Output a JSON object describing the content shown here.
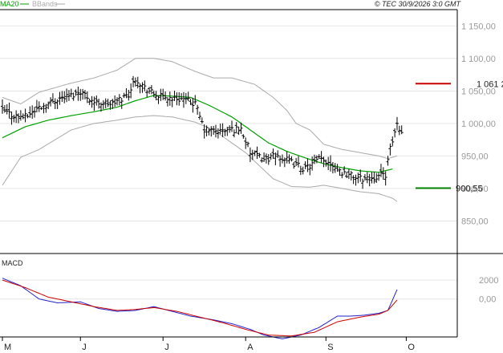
{
  "header": {
    "copyright": "© TEC 30/9/2026 3:0 GMT"
  },
  "chart_data": [
    {
      "type": "ohlc",
      "legend": [
        {
          "label": "MA20",
          "color": "#00a000"
        },
        {
          "label": "BBands",
          "color": "#aaaaaa"
        }
      ],
      "colors": {
        "bars": "#000000",
        "ma20": "#00a000",
        "bbands": "#aaaaaa",
        "resistance": "#cc0000",
        "support": "#008000"
      },
      "ylim": [
        800,
        1175
      ],
      "y_ticks": [
        {
          "value": 1150,
          "label": "1 150,00"
        },
        {
          "value": 1100,
          "label": "1 100,00"
        },
        {
          "value": 1050,
          "label": "1 050,00"
        },
        {
          "value": 1000,
          "label": "1 000,00"
        },
        {
          "value": 950,
          "label": "950,00"
        },
        {
          "value": 900,
          "label": "900,00"
        },
        {
          "value": 850,
          "label": "850,00"
        }
      ],
      "x_ticks": [
        "M",
        "J",
        "J",
        "A",
        "S",
        "O"
      ],
      "x_tick_index": [
        0,
        34,
        70,
        106,
        141,
        176
      ],
      "n_bars": 180,
      "price_anchors": [
        [
          0,
          1020
        ],
        [
          5,
          1012
        ],
        [
          10,
          1010
        ],
        [
          16,
          1025
        ],
        [
          20,
          1030
        ],
        [
          24,
          1038
        ],
        [
          30,
          1043
        ],
        [
          34,
          1050
        ],
        [
          40,
          1033
        ],
        [
          48,
          1030
        ],
        [
          55,
          1045
        ],
        [
          58,
          1070
        ],
        [
          62,
          1055
        ],
        [
          66,
          1045
        ],
        [
          70,
          1040
        ],
        [
          78,
          1038
        ],
        [
          84,
          1030
        ],
        [
          88,
          990
        ],
        [
          95,
          988
        ],
        [
          104,
          992
        ],
        [
          108,
          955
        ],
        [
          114,
          945
        ],
        [
          120,
          950
        ],
        [
          126,
          940
        ],
        [
          132,
          930
        ],
        [
          138,
          945
        ],
        [
          143,
          940
        ],
        [
          148,
          925
        ],
        [
          152,
          920
        ],
        [
          156,
          915
        ],
        [
          162,
          918
        ],
        [
          167,
          922
        ],
        [
          169,
          960
        ],
        [
          172,
          1000
        ],
        [
          174,
          985
        ]
      ],
      "ma20_anchors": [
        [
          0,
          978
        ],
        [
          10,
          995
        ],
        [
          20,
          1005
        ],
        [
          30,
          1012
        ],
        [
          40,
          1018
        ],
        [
          50,
          1025
        ],
        [
          58,
          1035
        ],
        [
          66,
          1043
        ],
        [
          74,
          1042
        ],
        [
          82,
          1040
        ],
        [
          90,
          1028
        ],
        [
          100,
          1010
        ],
        [
          108,
          990
        ],
        [
          116,
          970
        ],
        [
          124,
          957
        ],
        [
          132,
          947
        ],
        [
          140,
          938
        ],
        [
          148,
          932
        ],
        [
          156,
          927
        ],
        [
          164,
          925
        ],
        [
          170,
          930
        ]
      ],
      "bb_upper_anchors": [
        [
          0,
          1040
        ],
        [
          8,
          1030
        ],
        [
          16,
          1048
        ],
        [
          30,
          1062
        ],
        [
          40,
          1070
        ],
        [
          50,
          1082
        ],
        [
          58,
          1100
        ],
        [
          66,
          1100
        ],
        [
          74,
          1095
        ],
        [
          84,
          1080
        ],
        [
          92,
          1070
        ],
        [
          100,
          1070
        ],
        [
          110,
          1060
        ],
        [
          118,
          1040
        ],
        [
          124,
          1020
        ],
        [
          128,
          1000
        ],
        [
          134,
          990
        ],
        [
          140,
          968
        ],
        [
          148,
          960
        ],
        [
          156,
          955
        ],
        [
          164,
          950
        ],
        [
          168,
          946
        ],
        [
          172,
          950
        ]
      ],
      "bb_lower_anchors": [
        [
          0,
          905
        ],
        [
          8,
          948
        ],
        [
          16,
          960
        ],
        [
          30,
          990
        ],
        [
          40,
          1000
        ],
        [
          50,
          1005
        ],
        [
          58,
          1010
        ],
        [
          66,
          1012
        ],
        [
          74,
          1010
        ],
        [
          84,
          1002
        ],
        [
          92,
          990
        ],
        [
          100,
          970
        ],
        [
          106,
          955
        ],
        [
          112,
          935
        ],
        [
          118,
          915
        ],
        [
          126,
          903
        ],
        [
          134,
          902
        ],
        [
          140,
          905
        ],
        [
          148,
          900
        ],
        [
          156,
          895
        ],
        [
          164,
          892
        ],
        [
          170,
          885
        ],
        [
          172,
          880
        ]
      ],
      "levels": [
        {
          "name": "resistance",
          "value": 1061.2,
          "label": "1 061 2"
        },
        {
          "name": "support",
          "value": 900.55,
          "label": "900,55"
        }
      ]
    },
    {
      "type": "line",
      "title": "MACD",
      "ylim": [
        -4000,
        4800
      ],
      "y_ticks": [
        {
          "value": 2000,
          "label": "2000"
        },
        {
          "value": 0,
          "label": "0,00"
        }
      ],
      "series": [
        {
          "color": "#2222cc",
          "anchors": [
            [
              0,
              2200
            ],
            [
              8,
              1400
            ],
            [
              16,
              0
            ],
            [
              24,
              -400
            ],
            [
              34,
              -300
            ],
            [
              42,
              -1000
            ],
            [
              50,
              -1300
            ],
            [
              58,
              -1200
            ],
            [
              62,
              -1000
            ],
            [
              66,
              -800
            ],
            [
              74,
              -1300
            ],
            [
              82,
              -1800
            ],
            [
              92,
              -2200
            ],
            [
              100,
              -2600
            ],
            [
              108,
              -3200
            ],
            [
              114,
              -3800
            ],
            [
              122,
              -4200
            ],
            [
              130,
              -3800
            ],
            [
              138,
              -3000
            ],
            [
              146,
              -1800
            ],
            [
              152,
              -1800
            ],
            [
              158,
              -1700
            ],
            [
              164,
              -1500
            ],
            [
              168,
              -1200
            ],
            [
              172,
              1000
            ]
          ]
        },
        {
          "color": "#cc0000",
          "anchors": [
            [
              0,
              2000
            ],
            [
              10,
              1200
            ],
            [
              20,
              200
            ],
            [
              30,
              -300
            ],
            [
              40,
              -800
            ],
            [
              50,
              -1200
            ],
            [
              58,
              -1100
            ],
            [
              66,
              -900
            ],
            [
              76,
              -1300
            ],
            [
              86,
              -1900
            ],
            [
              96,
              -2500
            ],
            [
              106,
              -3200
            ],
            [
              116,
              -3800
            ],
            [
              126,
              -3900
            ],
            [
              136,
              -3500
            ],
            [
              146,
              -2400
            ],
            [
              156,
              -1900
            ],
            [
              164,
              -1600
            ],
            [
              168,
              -1200
            ],
            [
              172,
              -100
            ]
          ]
        }
      ]
    }
  ]
}
